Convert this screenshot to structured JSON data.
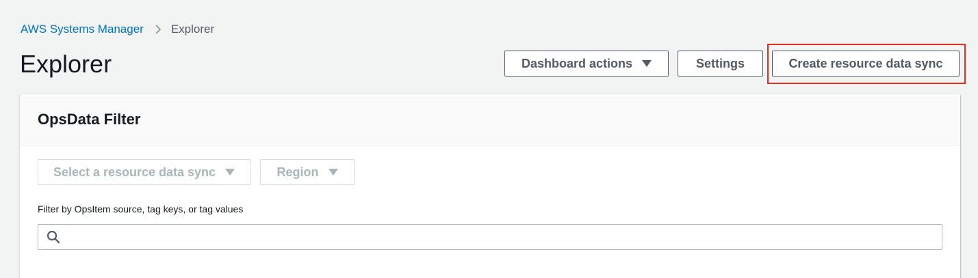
{
  "breadcrumb": {
    "parent": "AWS Systems Manager",
    "current": "Explorer"
  },
  "page": {
    "title": "Explorer"
  },
  "header_actions": {
    "dashboard_actions": "Dashboard actions",
    "settings": "Settings",
    "create_sync": "Create resource data sync"
  },
  "highlight": {
    "target": "create_sync",
    "color": "#e52d1e"
  },
  "panel": {
    "title": "OpsData Filter",
    "resource_sync_select": "Select a resource data sync",
    "region_select": "Region",
    "filter_label": "Filter by OpsItem source, tag keys, or tag values",
    "search_value": "",
    "search_placeholder": ""
  },
  "colors": {
    "link": "#0073bb",
    "background": "#f2f3f3",
    "button_text": "#545b64",
    "disabled_text": "#aab7b8"
  },
  "icons": {
    "breadcrumb_separator": "chevron-right-icon",
    "dropdown": "caret-down-icon",
    "search": "search-icon"
  }
}
